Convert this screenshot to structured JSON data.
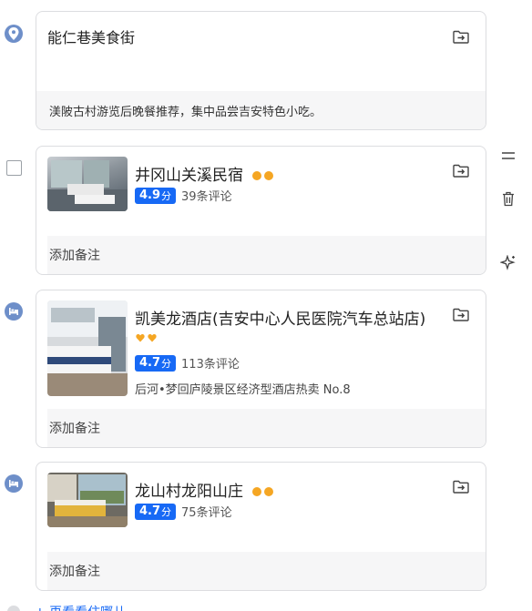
{
  "items": [
    {
      "title": "能仁巷美食街",
      "note": "渼陂古村游览后晚餐推荐，集中品尝吉安特色小吃。",
      "marker_icon": "location-pin-icon"
    },
    {
      "name": "井冈山关溪民宿",
      "rating": "4.9",
      "rating_unit": "分",
      "reviews": "39条评论",
      "note_placeholder": "添加备注",
      "level_dots": 2
    },
    {
      "name": "凯美龙酒店(吉安中心人民医院汽车总站店)",
      "rating": "4.7",
      "rating_unit": "分",
      "reviews": "113条评论",
      "rank": "后河•梦回庐陵景区经济型酒店热卖 No.8",
      "note_placeholder": "添加备注",
      "level_hearts": 2,
      "marker_icon": "bed-icon"
    },
    {
      "name": "龙山村龙阳山庄",
      "rating": "4.7",
      "rating_unit": "分",
      "reviews": "75条评论",
      "note_placeholder": "添加备注",
      "level_dots": 2,
      "marker_icon": "bed-icon"
    }
  ],
  "bottom_link": "+ 再看看住哪儿",
  "colors": {
    "accent": "#1769f5",
    "marker": "#6e8fc9",
    "level": "#f5a623"
  }
}
